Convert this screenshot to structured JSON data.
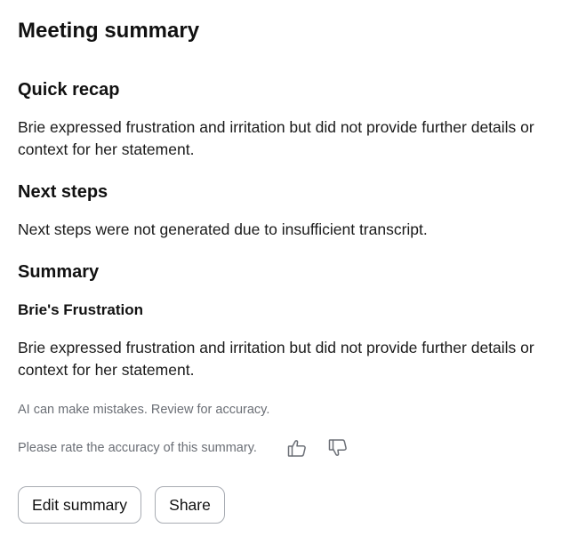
{
  "summary": {
    "title": "Meeting summary",
    "quick_recap": {
      "heading": "Quick recap",
      "text": "Brie expressed frustration and irritation but did not provide further details or context for her statement."
    },
    "next_steps": {
      "heading": "Next steps",
      "text": "Next steps were not generated due to insufficient transcript."
    },
    "summary_section": {
      "heading": "Summary",
      "subheading": "Brie's Frustration",
      "text": "Brie expressed frustration and irritation but did not provide further details or context for her statement."
    },
    "disclaimer": "AI can make mistakes. Review for accuracy.",
    "rating": {
      "prompt": "Please rate the accuracy of this summary.",
      "up_icon": "thumbs-up-icon",
      "down_icon": "thumbs-down-icon"
    },
    "actions": {
      "edit_label": "Edit summary",
      "share_label": "Share"
    }
  },
  "colors": {
    "text": "#111111",
    "muted": "#6b6f76",
    "border": "#a7abb2",
    "background": "#ffffff"
  }
}
